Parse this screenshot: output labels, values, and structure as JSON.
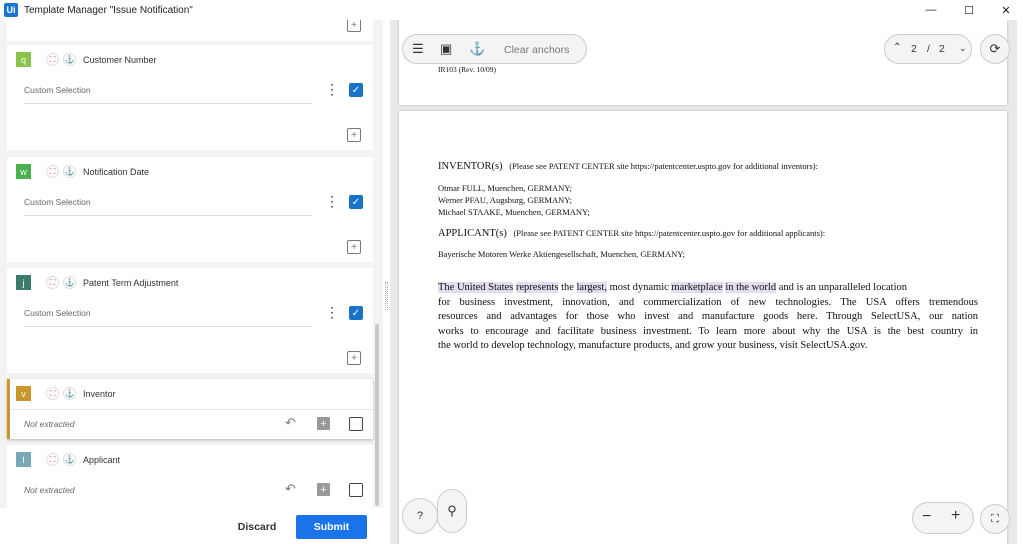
{
  "window": {
    "logo": "Ui",
    "title": "Template Manager \"Issue Notification\"",
    "controls": [
      "—",
      "☐",
      "✕"
    ]
  },
  "fields": [
    {
      "key": "q",
      "key_color": "#8bc34a",
      "name": "Customer Number",
      "value": "Custom Selection",
      "checked": true,
      "extracted": true
    },
    {
      "key": "w",
      "key_color": "#4caf50",
      "name": "Notification Date",
      "value": "Custom Selection",
      "checked": true,
      "extracted": true
    },
    {
      "key": "j",
      "key_color": "#3d7b6a",
      "name": "Patent Term Adjustment",
      "value": "Custom Selection",
      "checked": true,
      "extracted": true
    },
    {
      "key": "v",
      "key_color": "#c9962c",
      "name": "Inventor",
      "value": "Not extracted",
      "checked": false,
      "extracted": false
    },
    {
      "key": "l",
      "key_color": "#78a9b5",
      "name": "Applicant",
      "value": "Not extracted",
      "checked": false,
      "extracted": false
    }
  ],
  "footer": {
    "discard": "Discard",
    "submit": "Submit"
  },
  "viewer": {
    "clear_anchors": "Clear anchors",
    "page_current": "2",
    "page_sep": "/",
    "page_total": "2",
    "help": "?"
  },
  "document": {
    "prev_page_footer": "IR103 (Rev. 10/09)",
    "inventor_heading": "INVENTOR(s)",
    "inventor_note": "(Please see PATENT CENTER site https://patentcenter.uspto.gov for additional inventors):",
    "inventors": [
      "Otmar FULL, Muenchen, GERMANY;",
      "Werner PFAU, Augsburg, GERMANY;",
      "Michael STAAKE, Muenchen, GERMANY;"
    ],
    "applicant_heading": "APPLICANT(s)",
    "applicant_note": "(Please see PATENT CENTER site https://patentcenter.uspto.gov for additional applicants):",
    "applicant": "Bayerische Motoren Werke Aktiengesellschaft, Muenchen, GERMANY;",
    "para_lines": [
      "The United States represents the largest, most dynamic marketplace in the world and is an unparalleled location",
      "for business investment, innovation, and commercialization of new technologies. The USA offers tremendous",
      "resources and advantages for those who invest and manufacture goods here. Through SelectUSA, our nation",
      "works to encourage and facilitate business investment. To learn more about why the USA is the best country in",
      "the world to develop technology, manufacture products, and grow your business, visit SelectUSA.gov."
    ]
  }
}
